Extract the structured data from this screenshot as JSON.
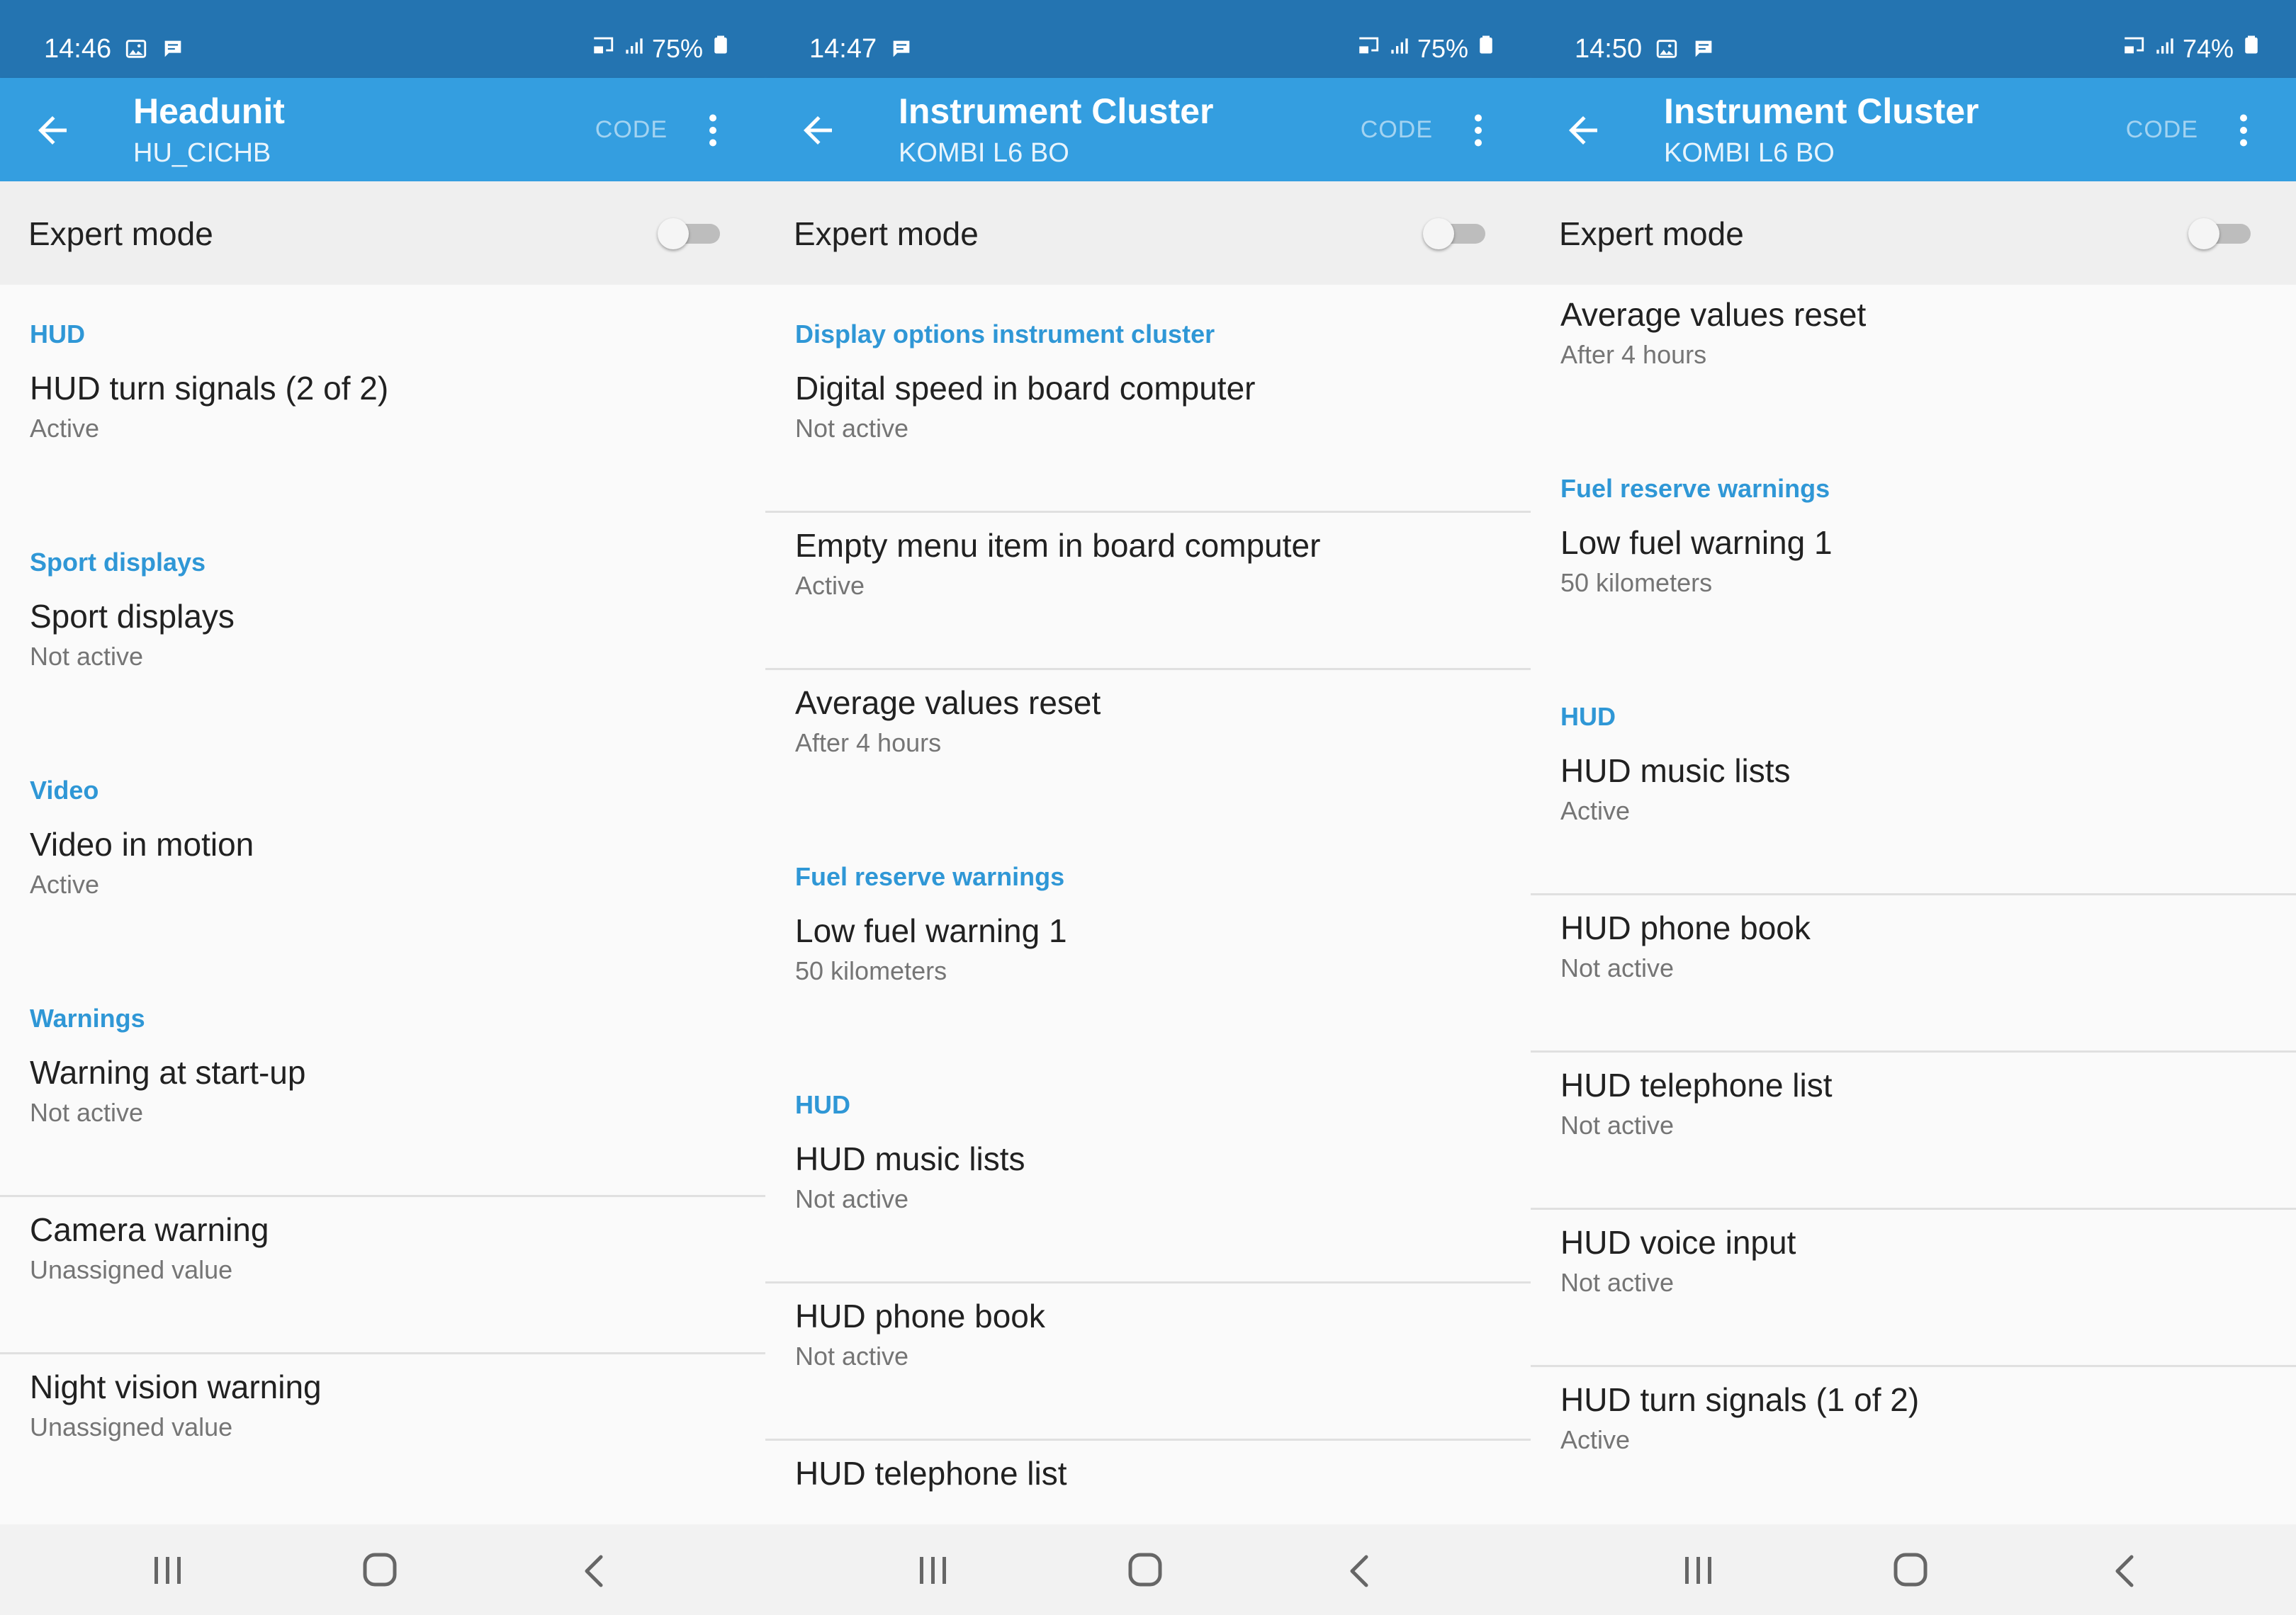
{
  "panels": [
    {
      "status_bar": {
        "time": "14:46",
        "battery": "75%",
        "icons_left": [
          "image-icon",
          "notification-icon"
        ]
      },
      "app_bar": {
        "title": "Headunit",
        "subtitle": "HU_CICHB",
        "code_label": "CODE"
      },
      "expert_mode": {
        "label": "Expert mode",
        "enabled": false
      },
      "sections": [
        {
          "header": "HUD",
          "items": [
            {
              "title": "HUD turn signals (2 of 2)",
              "value": "Active",
              "divider": false
            }
          ]
        },
        {
          "header": "Sport displays",
          "items": [
            {
              "title": "Sport displays",
              "value": "Not active",
              "divider": false
            }
          ]
        },
        {
          "header": "Video",
          "items": [
            {
              "title": "Video in motion",
              "value": "Active",
              "divider": false
            }
          ]
        },
        {
          "header": "Warnings",
          "items": [
            {
              "title": "Warning at start-up",
              "value": "Not active",
              "divider": true
            },
            {
              "title": "Camera warning",
              "value": "Unassigned value",
              "divider": true
            },
            {
              "title": "Night vision warning",
              "value": "Unassigned value",
              "divider": false
            }
          ]
        }
      ]
    },
    {
      "status_bar": {
        "time": "14:47",
        "battery": "75%",
        "icons_left": [
          "notification-icon"
        ]
      },
      "app_bar": {
        "title": "Instrument Cluster",
        "subtitle": "KOMBI L6 BO",
        "code_label": "CODE"
      },
      "expert_mode": {
        "label": "Expert mode",
        "enabled": false
      },
      "sections": [
        {
          "header": "Display options instrument cluster",
          "items": [
            {
              "title": "Digital speed in board computer",
              "value": "Not active",
              "divider": true
            },
            {
              "title": "Empty menu item in board computer",
              "value": "Active",
              "divider": true
            },
            {
              "title": "Average values reset",
              "value": "After 4 hours",
              "divider": false
            }
          ]
        },
        {
          "header": "Fuel reserve warnings",
          "items": [
            {
              "title": "Low fuel warning 1",
              "value": "50 kilometers",
              "divider": false
            }
          ]
        },
        {
          "header": "HUD",
          "items": [
            {
              "title": "HUD music lists",
              "value": "Not active",
              "divider": true
            },
            {
              "title": "HUD phone book",
              "value": "Not active",
              "divider": true
            },
            {
              "title": "HUD telephone list",
              "value": "",
              "divider": false
            }
          ]
        }
      ]
    },
    {
      "status_bar": {
        "time": "14:50",
        "battery": "74%",
        "icons_left": [
          "image-icon",
          "notification-icon"
        ]
      },
      "app_bar": {
        "title": "Instrument Cluster",
        "subtitle": "KOMBI L6 BO",
        "code_label": "CODE"
      },
      "expert_mode": {
        "label": "Expert mode",
        "enabled": false
      },
      "sections": [
        {
          "header": "",
          "items": [
            {
              "title": "Average values reset",
              "value": "After 4 hours",
              "divider": false
            }
          ]
        },
        {
          "header": "Fuel reserve warnings",
          "items": [
            {
              "title": "Low fuel warning 1",
              "value": "50 kilometers",
              "divider": false
            }
          ]
        },
        {
          "header": "HUD",
          "items": [
            {
              "title": "HUD music lists",
              "value": "Active",
              "divider": true
            },
            {
              "title": "HUD phone book",
              "value": "Not active",
              "divider": true
            },
            {
              "title": "HUD telephone list",
              "value": "Not active",
              "divider": true
            },
            {
              "title": "HUD voice input",
              "value": "Not active",
              "divider": true
            },
            {
              "title": "HUD turn signals (1 of 2)",
              "value": "Active",
              "divider": false
            }
          ]
        }
      ]
    }
  ],
  "colors": {
    "status_bar": "#2474b1",
    "app_bar": "#349ee0",
    "section_header": "#2f97d6"
  }
}
